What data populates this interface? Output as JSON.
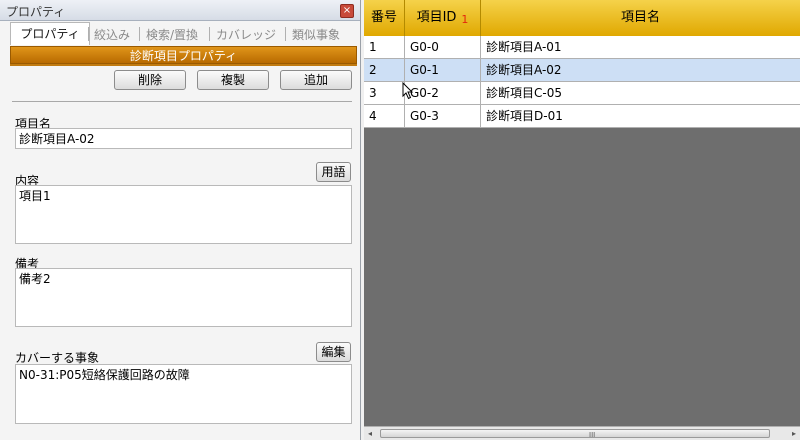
{
  "panel": {
    "title": "プロパティ",
    "close_glyph": "×",
    "tabs": [
      {
        "label": "プロパティ"
      },
      {
        "label": "絞込み"
      },
      {
        "label": "検索/置換"
      },
      {
        "label": "カバレッジ"
      },
      {
        "label": "類似事象"
      }
    ],
    "section_title": "診断項目プロパティ",
    "buttons": {
      "delete": "削除",
      "duplicate": "複製",
      "add": "追加"
    },
    "fields": {
      "item_name": {
        "label": "項目名",
        "value": "診断項目A-02"
      },
      "content": {
        "label": "内容",
        "value": "項目1",
        "button": "用語"
      },
      "remarks": {
        "label": "備考",
        "value": "備考2"
      },
      "covered_events": {
        "label": "カバーする事象",
        "value": "N0-31:P05短絡保護回路の故障",
        "button": "編集"
      }
    }
  },
  "grid": {
    "columns": {
      "no": "番号",
      "id": "項目ID",
      "id_sort": "1",
      "name": "項目名"
    },
    "rows": [
      {
        "no": "1",
        "id": "G0-0",
        "name": "診断項目A-01",
        "selected": false
      },
      {
        "no": "2",
        "id": "G0-1",
        "name": "診断項目A-02",
        "selected": true
      },
      {
        "no": "3",
        "id": "G0-2",
        "name": "診断項目C-05",
        "selected": false
      },
      {
        "no": "4",
        "id": "G0-3",
        "name": "診断項目D-01",
        "selected": false
      }
    ],
    "scroll": {
      "left_arrow": "◂",
      "right_arrow": "▸",
      "grip": "III"
    }
  },
  "colors": {
    "header_gold": "#e0a800",
    "section_orange": "#c87c08",
    "selected_row": "#cddff5"
  }
}
